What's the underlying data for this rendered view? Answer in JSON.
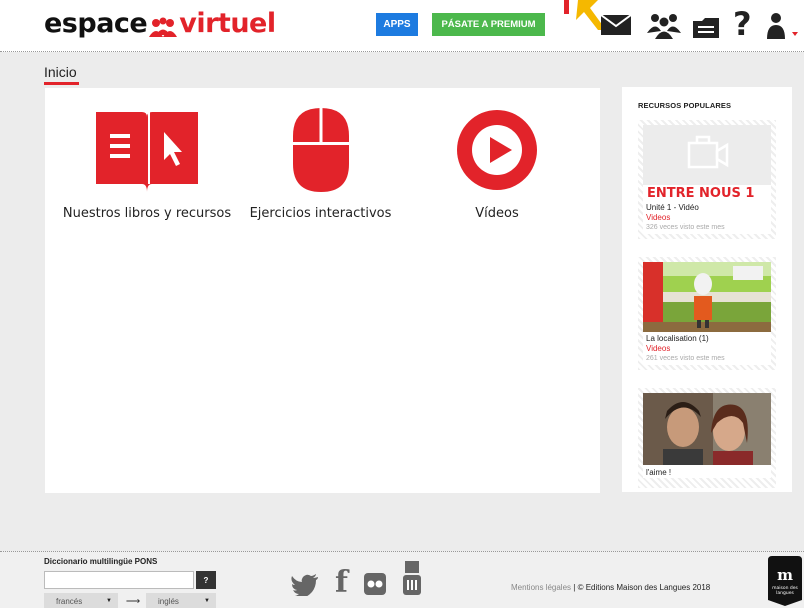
{
  "header": {
    "logo_part1": "espace",
    "logo_part2": "virtuel",
    "apps_label": "APPS",
    "premium_label": "PÁSATE A PREMIUM",
    "help_glyph": "?",
    "icons": [
      "mail-icon",
      "community-icon",
      "folder-icon",
      "help-icon",
      "user-icon"
    ]
  },
  "breadcrumb": "Inicio",
  "tiles": [
    {
      "label": "Nuestros libros y recursos",
      "icon": "book-icon"
    },
    {
      "label": "Ejercicios interactivos",
      "icon": "mouse-icon"
    },
    {
      "label": "Vídeos",
      "icon": "play-icon"
    }
  ],
  "sidebar": {
    "title": "RECURSOS POPULARES",
    "cards": [
      {
        "banner": "ENTRE NOUS 1",
        "title": "Unité 1 - Vidéo",
        "category": "Videos",
        "views": "326 veces visto este mes"
      },
      {
        "title": "La localisation (1)",
        "category": "Videos",
        "views": "261 veces visto este mes"
      },
      {
        "title": "l'aime !"
      }
    ]
  },
  "footer": {
    "dict_title": "Diccionario multilingüe PONS",
    "dict_go": "?",
    "dict_input_placeholder": "",
    "from_lang": "francés",
    "to_lang": "inglés",
    "arrow": "⟶",
    "social": [
      "twitter-icon",
      "facebook-icon",
      "flickr-icon",
      "youtube-icon"
    ],
    "legal_link": "Mentions légales",
    "copyright": "© Editions Maison des Langues 2018",
    "badge_text": "maison des langues"
  },
  "colors": {
    "accent": "#e2232a",
    "apps": "#1d7be0",
    "premium": "#4cb84c",
    "arrow": "#f5b800"
  }
}
